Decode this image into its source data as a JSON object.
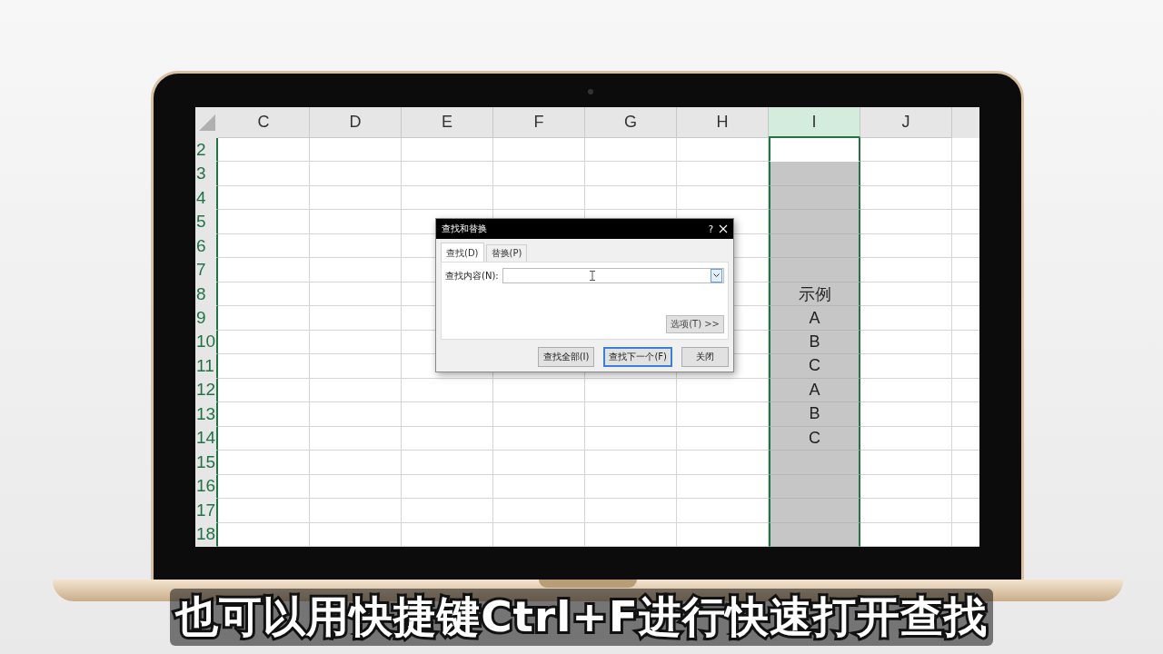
{
  "spreadsheet": {
    "columns": [
      {
        "label": "C",
        "selected": false
      },
      {
        "label": "D",
        "selected": false
      },
      {
        "label": "E",
        "selected": false
      },
      {
        "label": "F",
        "selected": false
      },
      {
        "label": "G",
        "selected": false
      },
      {
        "label": "H",
        "selected": false
      },
      {
        "label": "I",
        "selected": true
      },
      {
        "label": "J",
        "selected": false
      }
    ],
    "rows": [
      {
        "label": "2",
        "column_I": {
          "shaded": false
        }
      },
      {
        "label": "3",
        "column_I": {
          "shaded": true
        }
      },
      {
        "label": "4",
        "column_I": {
          "shaded": true
        }
      },
      {
        "label": "5",
        "column_I": {
          "shaded": true
        }
      },
      {
        "label": "6",
        "column_I": {
          "shaded": true
        }
      },
      {
        "label": "7",
        "column_I": {
          "shaded": true
        }
      },
      {
        "label": "8",
        "column_I": {
          "shaded": true,
          "text": "示例"
        }
      },
      {
        "label": "9",
        "column_I": {
          "shaded": true,
          "text": "A"
        }
      },
      {
        "label": "10",
        "column_I": {
          "shaded": true,
          "text": "B"
        }
      },
      {
        "label": "11",
        "column_I": {
          "shaded": true,
          "text": "C"
        }
      },
      {
        "label": "12",
        "column_I": {
          "shaded": true,
          "text": "A"
        }
      },
      {
        "label": "13",
        "column_I": {
          "shaded": true,
          "text": "B"
        }
      },
      {
        "label": "14",
        "column_I": {
          "shaded": true,
          "text": "C"
        }
      },
      {
        "label": "15",
        "column_I": {
          "shaded": true
        }
      },
      {
        "label": "16",
        "column_I": {
          "shaded": true
        }
      },
      {
        "label": "17",
        "column_I": {
          "shaded": true
        }
      },
      {
        "label": "18",
        "column_I": {
          "shaded": true
        }
      }
    ]
  },
  "dialog": {
    "title": "查找和替换",
    "help": "?",
    "tabs": [
      {
        "label": "查找(D)",
        "selected": true
      },
      {
        "label": "替换(P)",
        "selected": false
      }
    ],
    "find_label": "查找内容(N):",
    "options_button": "选项(T) >>",
    "buttons": [
      {
        "label": "查找全部(I)",
        "default": false
      },
      {
        "label": "查找下一个(F)",
        "default": true
      },
      {
        "label": "关闭",
        "default": false
      }
    ]
  },
  "subtitle": "也可以用快捷键Ctrl+F进行快速打开查找"
}
